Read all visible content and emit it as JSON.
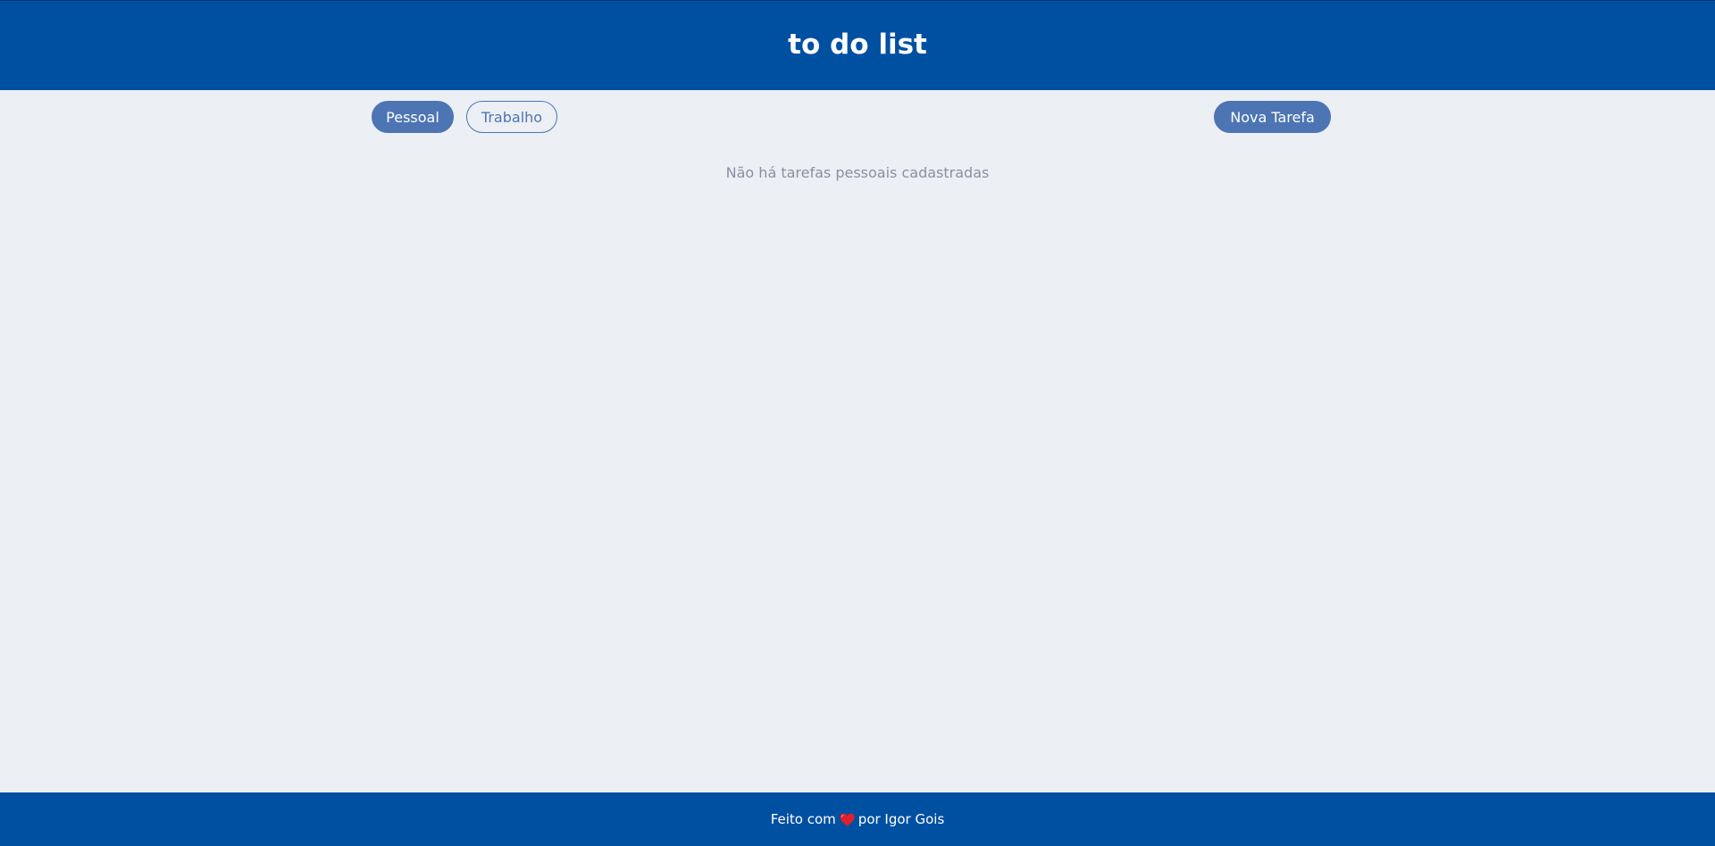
{
  "header": {
    "title": "to do list"
  },
  "tabs": [
    {
      "label": "Pessoal",
      "active": true
    },
    {
      "label": "Trabalho",
      "active": false
    }
  ],
  "actions": {
    "new_task_label": "Nova Tarefa"
  },
  "main": {
    "empty_message": "Não há tarefas pessoais cadastradas"
  },
  "footer": {
    "text_before": "Feito com",
    "icon": "heart-icon",
    "text_after": "por Igor Gois"
  },
  "colors": {
    "header_bg": "#0050a1",
    "page_bg": "#eceff3",
    "accent": "#4d75b3",
    "muted_text": "#8a8fa3",
    "heart": "#e0202e"
  }
}
